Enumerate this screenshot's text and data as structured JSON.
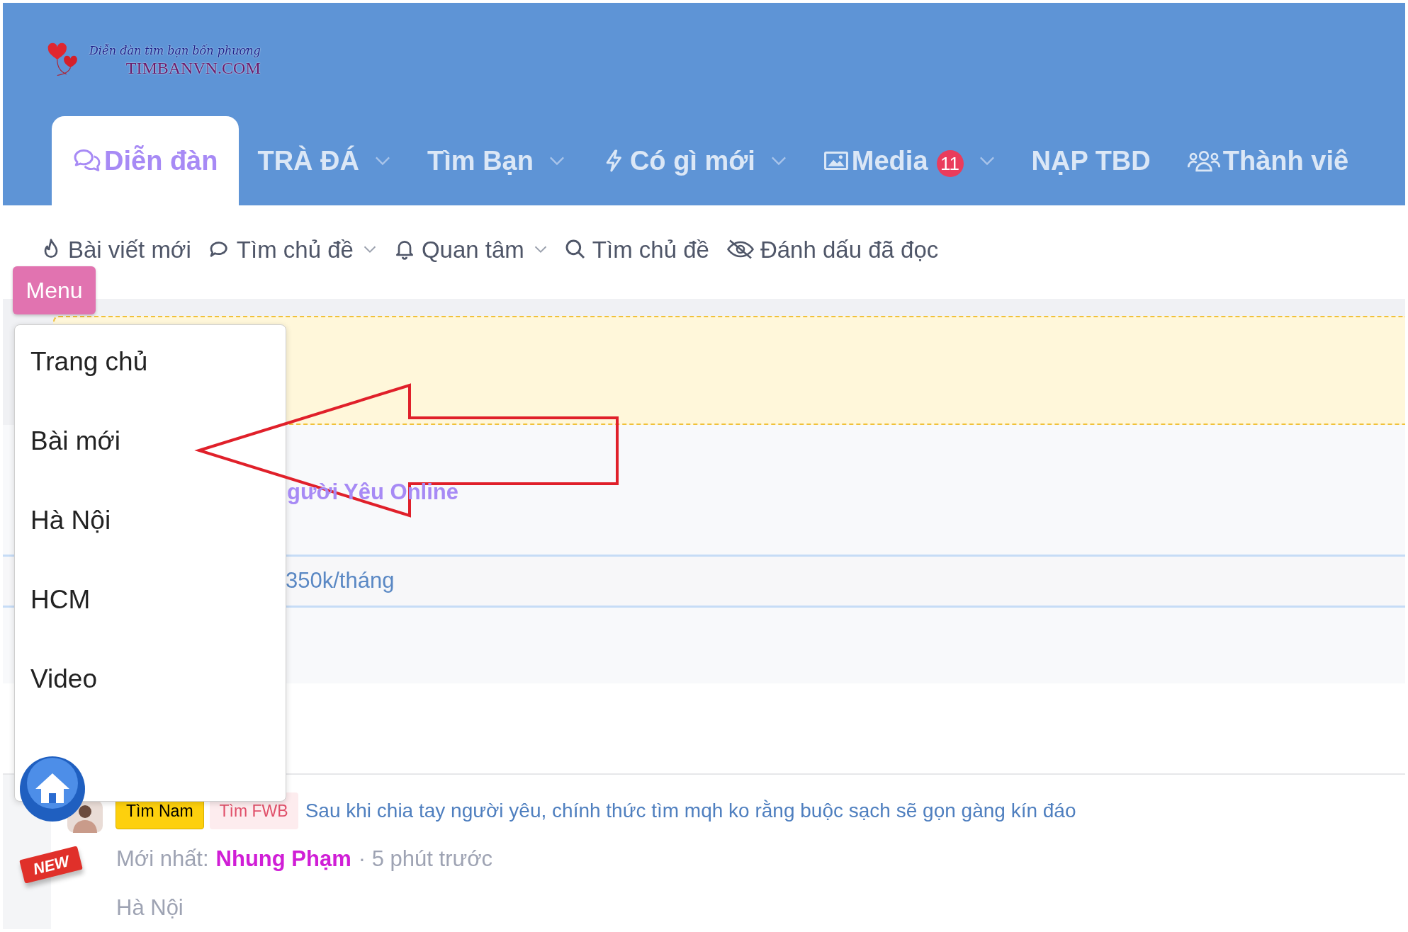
{
  "logo": {
    "tagline": "Diễn đàn tìm bạn bốn phương",
    "site": "TIMBANVN.COM"
  },
  "nav_tabs": [
    {
      "label": "Diễn đàn",
      "selected": true,
      "dropdown": false
    },
    {
      "label": "TRÀ ĐÁ",
      "selected": false,
      "dropdown": true
    },
    {
      "label": "Tìm Bạn",
      "selected": false,
      "dropdown": true
    },
    {
      "label": "Có gì mới",
      "selected": false,
      "dropdown": true
    },
    {
      "label": "Media",
      "badge": "11",
      "selected": false,
      "dropdown": true
    },
    {
      "label": "NẠP TBD",
      "selected": false,
      "dropdown": false
    },
    {
      "label": "Thành viê",
      "selected": false,
      "dropdown": false
    }
  ],
  "sub_nav": [
    {
      "label": "Bài viết mới",
      "dropdown": false
    },
    {
      "label": "Tìm chủ đề",
      "dropdown": true
    },
    {
      "label": "Quan tâm",
      "dropdown": true
    },
    {
      "label": "Tìm chủ đề",
      "dropdown": false
    },
    {
      "label": "Đánh dấu đã đọc",
      "dropdown": false
    }
  ],
  "menu_button": "Menu",
  "menu_items": [
    "Trang chủ",
    "Bài mới",
    "Hà Nội",
    "HCM",
    "Video"
  ],
  "forum_title": "gười Yêu Online",
  "promo": "350k/tháng",
  "thread": {
    "tags": [
      {
        "label": "Tìm Nam",
        "kind": "solid"
      },
      {
        "label": "Tìm FWB",
        "kind": "soft"
      }
    ],
    "title": "Sau khi chia tay người yêu, chính thức tìm mqh ko rằng buộc sạch sẽ gọn gàng kín đáo",
    "latest_label": "Mới nhất:",
    "author": "Nhung Phạm",
    "time": "· 5 phút trước",
    "location": "Hà Nội",
    "new_badge": "NEW"
  }
}
